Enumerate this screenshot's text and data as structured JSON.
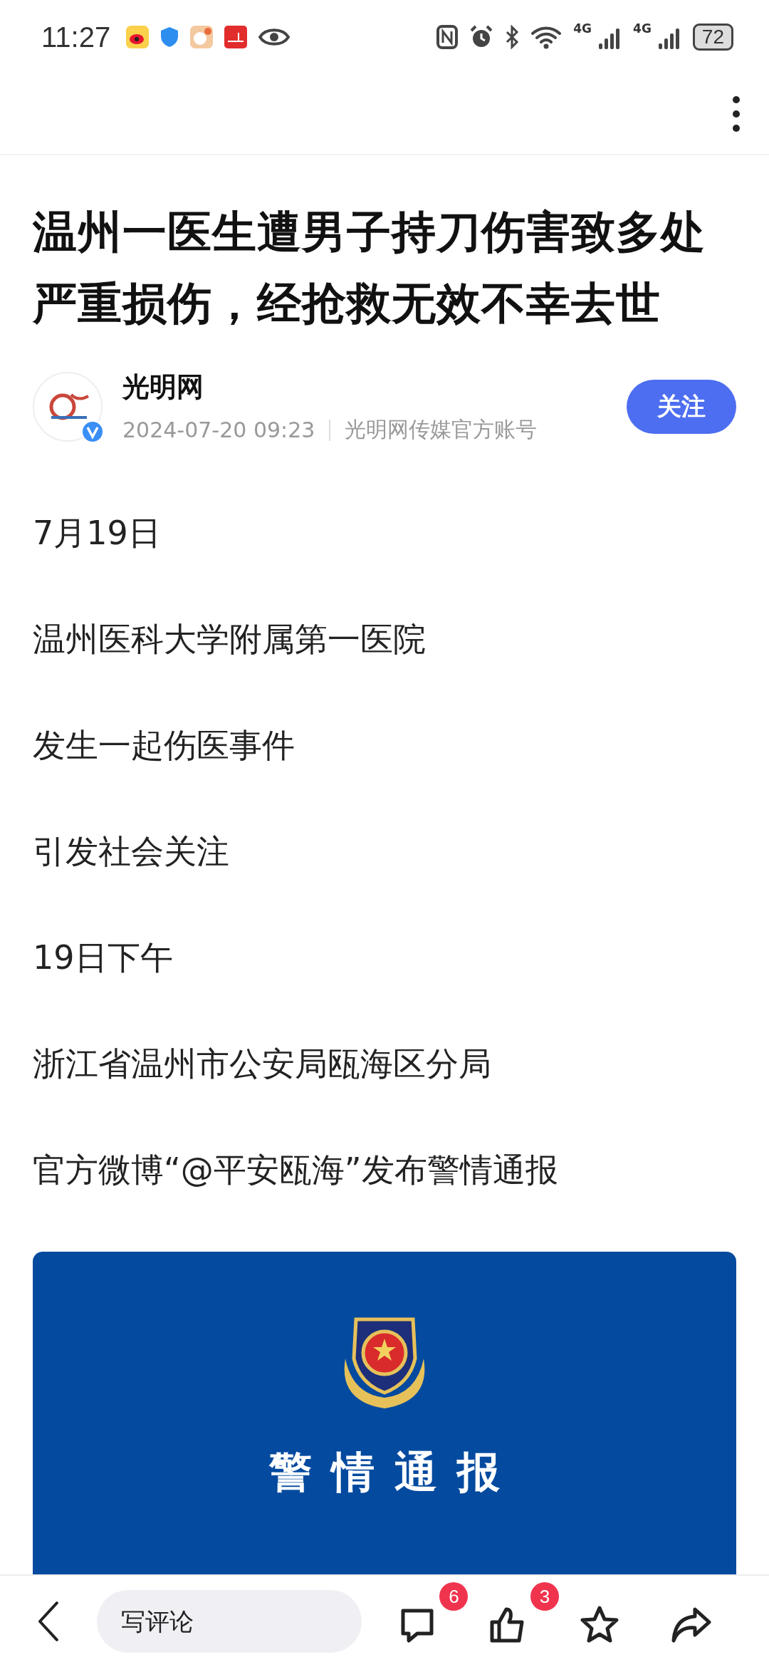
{
  "status_bar": {
    "time": "11:27",
    "network_labels": [
      "4G",
      "4G"
    ],
    "battery": "72"
  },
  "article": {
    "title": "温州一医生遭男子持刀伤害致多处严重损伤，经抢救无效不幸去世",
    "author": {
      "name": "光明网",
      "verified": true,
      "date": "2024-07-20 09:23",
      "description": "光明网传媒官方账号",
      "follow_label": "关注",
      "followed": false
    },
    "paragraphs": [
      "7月19日",
      "温州医科大学附属第一医院",
      "发生一起伤医事件",
      "引发社会关注",
      "19日下午",
      "浙江省温州市公安局瓯海区分局",
      "官方微博“@平安瓯海”发布警情通报"
    ],
    "banner": {
      "title": "警情通报"
    }
  },
  "bottom_bar": {
    "comment_placeholder": "写评论",
    "comment_count": "6",
    "like_count": "3"
  }
}
